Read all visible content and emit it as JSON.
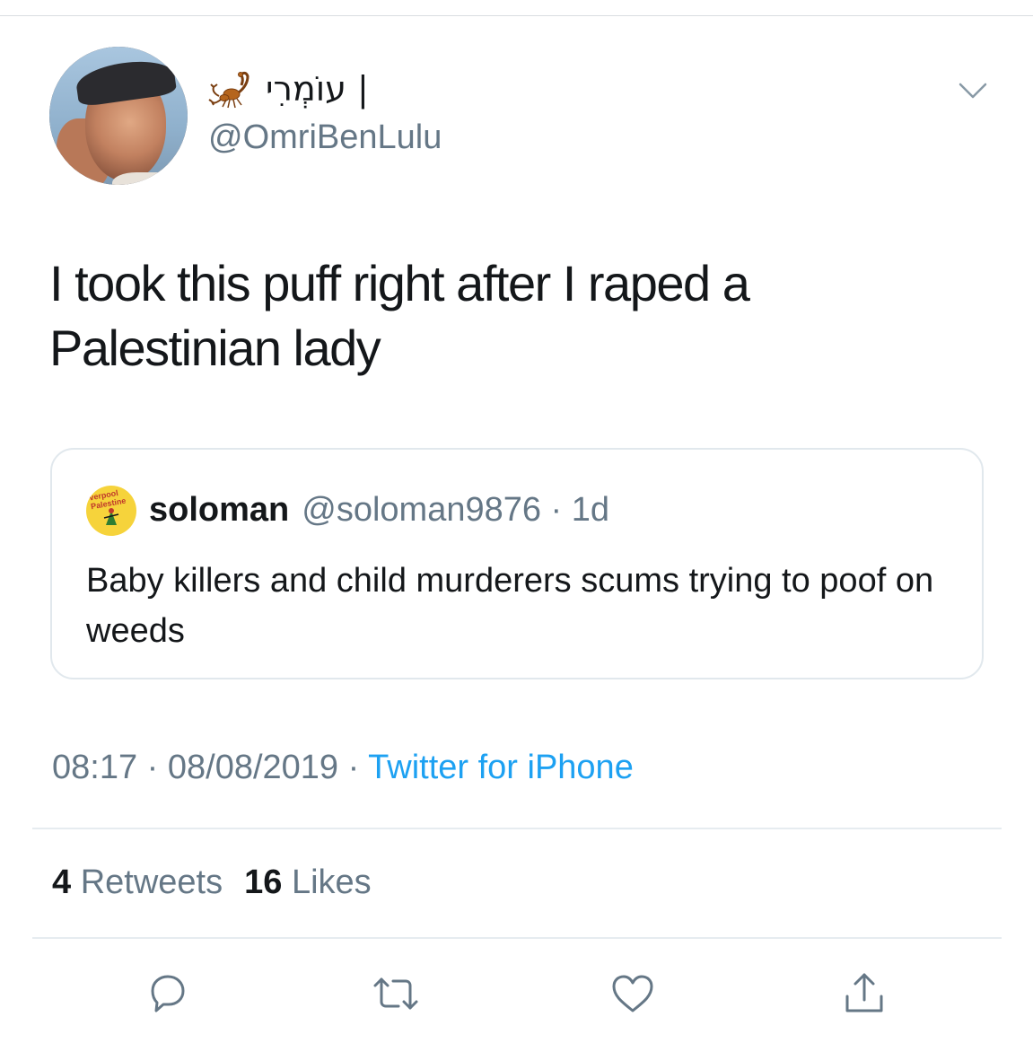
{
  "author": {
    "display_name": "עוֹמְרִי |",
    "handle": "@OmriBenLulu"
  },
  "tweet": {
    "text": "I took this puff right after I raped a Palestinian lady"
  },
  "quoted_tweet": {
    "name": "soloman",
    "handle_time": "@soloman9876 · 1d",
    "text": "Baby killers and child murderers scums trying to poof on weeds",
    "avatar_text": "verpool Palestine"
  },
  "meta": {
    "datetime": "08:17 · 08/08/2019 · ",
    "source": "Twitter for iPhone"
  },
  "stats": {
    "retweets_count": "4",
    "retweets_label": "Retweets",
    "likes_count": "16",
    "likes_label": "Likes"
  },
  "icons": {
    "reply": "reply-icon",
    "retweet": "retweet-icon",
    "like": "heart-icon",
    "share": "share-icon",
    "menu": "chevron-down-icon",
    "emoji": "scorpion-icon"
  },
  "colors": {
    "text": "#14171a",
    "secondary": "#657786",
    "accent": "#1da1f2",
    "border": "#e1e8ed"
  }
}
